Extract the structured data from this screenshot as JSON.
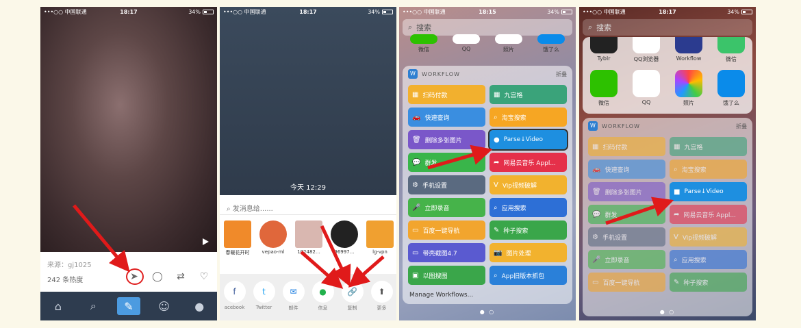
{
  "status": {
    "carrier": "•••○○ 中国联通",
    "battery": "34%",
    "times": [
      "18:17",
      "18:17",
      "18:15",
      "18:17"
    ]
  },
  "phone1": {
    "source": "来源：gj1025",
    "heat": "242 条热度",
    "tabs": [
      "home-icon",
      "search-icon",
      "edit-icon",
      "emoji-icon",
      "profile-icon"
    ]
  },
  "phone2": {
    "time": "今天 12:29",
    "message_placeholder": "发消息给......",
    "contacts": [
      {
        "name": "春暖花开时",
        "color": "#f08a2a"
      },
      {
        "name": "vepao-ml",
        "color": "#e0673b"
      },
      {
        "name": "102482…",
        "color": "#d9b7b0"
      },
      {
        "name": "96997…",
        "color": "#222222"
      },
      {
        "name": "lg-vpn",
        "color": "#f0a030"
      }
    ],
    "shares": [
      {
        "label": "acebook",
        "icon": "f",
        "color": "#3b5998"
      },
      {
        "label": "Twitter",
        "icon": "t",
        "color": "#1da1f2"
      },
      {
        "label": "邮件",
        "icon": "✉",
        "color": "#1a7de0"
      },
      {
        "label": "信息",
        "icon": "●",
        "color": "#22b14c"
      },
      {
        "label": "复制",
        "icon": "🔗",
        "color": "#555555"
      },
      {
        "label": "更多",
        "icon": "⬆",
        "color": "#555555"
      }
    ]
  },
  "phone3": {
    "search": "搜索",
    "apps": [
      "微信",
      "QQ",
      "照片",
      "饿了么"
    ],
    "widget_title": "WORKFLOW",
    "collapse": "折叠",
    "buttons": [
      {
        "label": "扫码付款",
        "icon": "▦",
        "color": "#f2b02e"
      },
      {
        "label": "九宫格",
        "icon": "▦",
        "color": "#3aa37a"
      },
      {
        "label": "快速查询",
        "icon": "🚗",
        "color": "#3a8ee0"
      },
      {
        "label": "淘宝搜索",
        "icon": "⌕",
        "color": "#f6a623"
      },
      {
        "label": "删除多张图片",
        "icon": "🗑",
        "color": "#7a57c9"
      },
      {
        "label": "Parse↓Video",
        "icon": "●",
        "color": "#1e8fe0"
      },
      {
        "label": "群发",
        "icon": "💬",
        "color": "#39b54a"
      },
      {
        "label": "网易云音乐  Appl...",
        "icon": "➦",
        "color": "#e5304a"
      },
      {
        "label": "手机设置",
        "icon": "⚙",
        "color": "#5a6a80"
      },
      {
        "label": "Vip视频破解",
        "icon": "V",
        "color": "#f2b22e"
      },
      {
        "label": "立即录音",
        "icon": "🎤",
        "color": "#46b34a"
      },
      {
        "label": "应用搜索",
        "icon": "⌕",
        "color": "#2d6fd6"
      },
      {
        "label": "百度一键导航",
        "icon": "▭",
        "color": "#f2a52e"
      },
      {
        "label": "种子搜索",
        "icon": "✎",
        "color": "#3aa64a"
      },
      {
        "label": "带壳截图4.7",
        "icon": "▭",
        "color": "#5a5ad0"
      },
      {
        "label": "图片处理",
        "icon": "📷",
        "color": "#f2b22e"
      },
      {
        "label": "以图搜图",
        "icon": "▣",
        "color": "#3aa64a"
      },
      {
        "label": "App旧版本抓包",
        "icon": "⌕",
        "color": "#2a80d9"
      }
    ],
    "manage": "Manage Workflows..."
  },
  "phone4": {
    "search": "搜索",
    "apps_top": [
      "Tyblr",
      "QQ浏览器",
      "Workflow",
      "微信"
    ],
    "apps": [
      "微信",
      "QQ",
      "照片",
      "饿了么"
    ],
    "widget_title": "WORKFLOW",
    "collapse": "折叠",
    "buttons": [
      {
        "label": "扫码付款",
        "icon": "▦",
        "color": "#f2b02e"
      },
      {
        "label": "九宫格",
        "icon": "▦",
        "color": "#3aa37a"
      },
      {
        "label": "快速查询",
        "icon": "🚗",
        "color": "#3a8ee0"
      },
      {
        "label": "淘宝搜索",
        "icon": "⌕",
        "color": "#f6a623"
      },
      {
        "label": "删除多张图片",
        "icon": "🗑",
        "color": "#7a57c9"
      },
      {
        "label": "Parse↓Video",
        "icon": "■",
        "color": "#1e8fe0"
      },
      {
        "label": "群发",
        "icon": "💬",
        "color": "#39b54a"
      },
      {
        "label": "网易云音乐  Appl...",
        "icon": "➦",
        "color": "#e5304a"
      },
      {
        "label": "手机设置",
        "icon": "⚙",
        "color": "#5a6a80"
      },
      {
        "label": "Vip视频破解",
        "icon": "V",
        "color": "#f2b22e"
      },
      {
        "label": "立即录音",
        "icon": "🎤",
        "color": "#46b34a"
      },
      {
        "label": "应用搜索",
        "icon": "⌕",
        "color": "#2d6fd6"
      },
      {
        "label": "百度一键导航",
        "icon": "▭",
        "color": "#f2a52e"
      },
      {
        "label": "种子搜索",
        "icon": "✎",
        "color": "#3aa64a"
      }
    ]
  }
}
